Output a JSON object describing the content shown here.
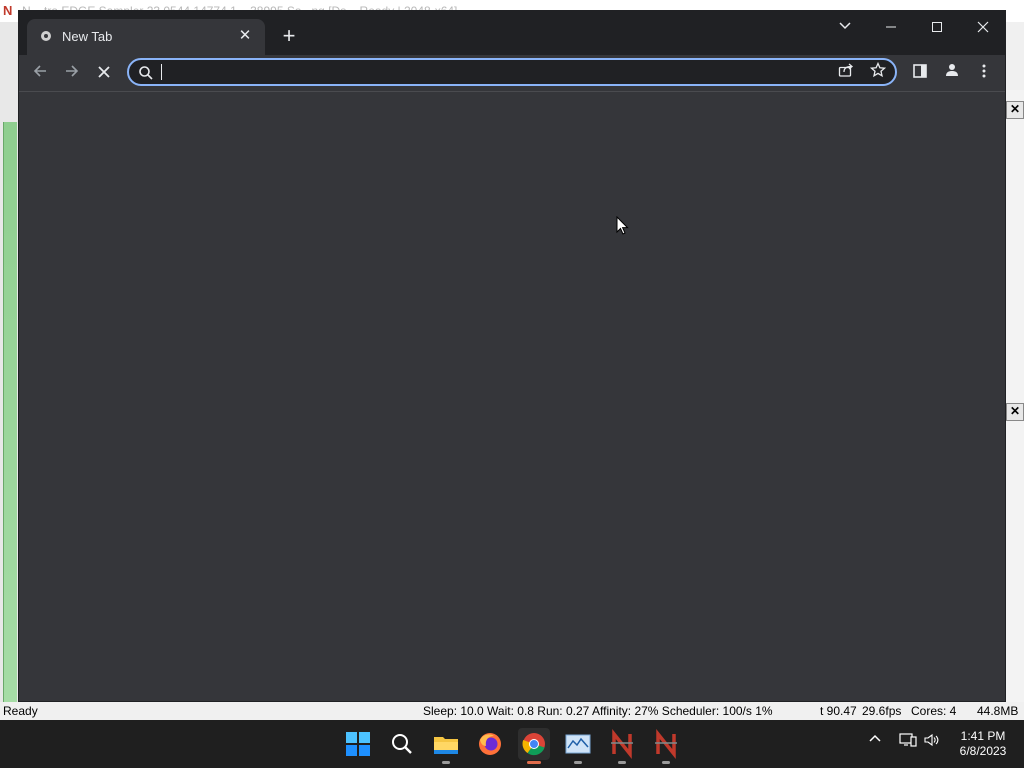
{
  "background_app": {
    "title_text": "N... tra EDGE Sampler 23.0544.14774.1 – 38995 Sa...ng [Ds... Ready | 2048-x64]"
  },
  "browser": {
    "tab": {
      "title": "New Tab",
      "close_glyph": "✕"
    },
    "new_tab_glyph": "+",
    "window_controls": {
      "tabsearch": "⌄",
      "minimize": "—",
      "maximize": "☐",
      "close": "✕"
    },
    "nav": {
      "back": "←",
      "forward": "→",
      "stop": "✕"
    },
    "omnibox": {
      "value": "",
      "placeholder": ""
    }
  },
  "status_bar": {
    "left": "Ready",
    "stats": "Sleep: 10.0 Wait: 0.8 Run: 0.27 Affinity: 27% Scheduler: 100/s 1%",
    "time_stat": "t 90.47",
    "fps": "29.6fps",
    "cores": "Cores: 4",
    "memory": "44.8MB"
  },
  "taskbar": {
    "clock_time": "1:41 PM",
    "clock_date": "6/8/2023",
    "apps": [
      "start-icon",
      "search-icon",
      "file-explorer-icon",
      "firefox-icon",
      "chrome-icon",
      "monitor-app-icon",
      "ntrace-app-icon",
      "ntrace-app-icon-2"
    ]
  },
  "colors": {
    "browser_bg": "#35363a",
    "tabstrip_bg": "#202124",
    "omnibox_focus": "#8ab4f8",
    "taskbar_bg": "#1f1f1f"
  }
}
